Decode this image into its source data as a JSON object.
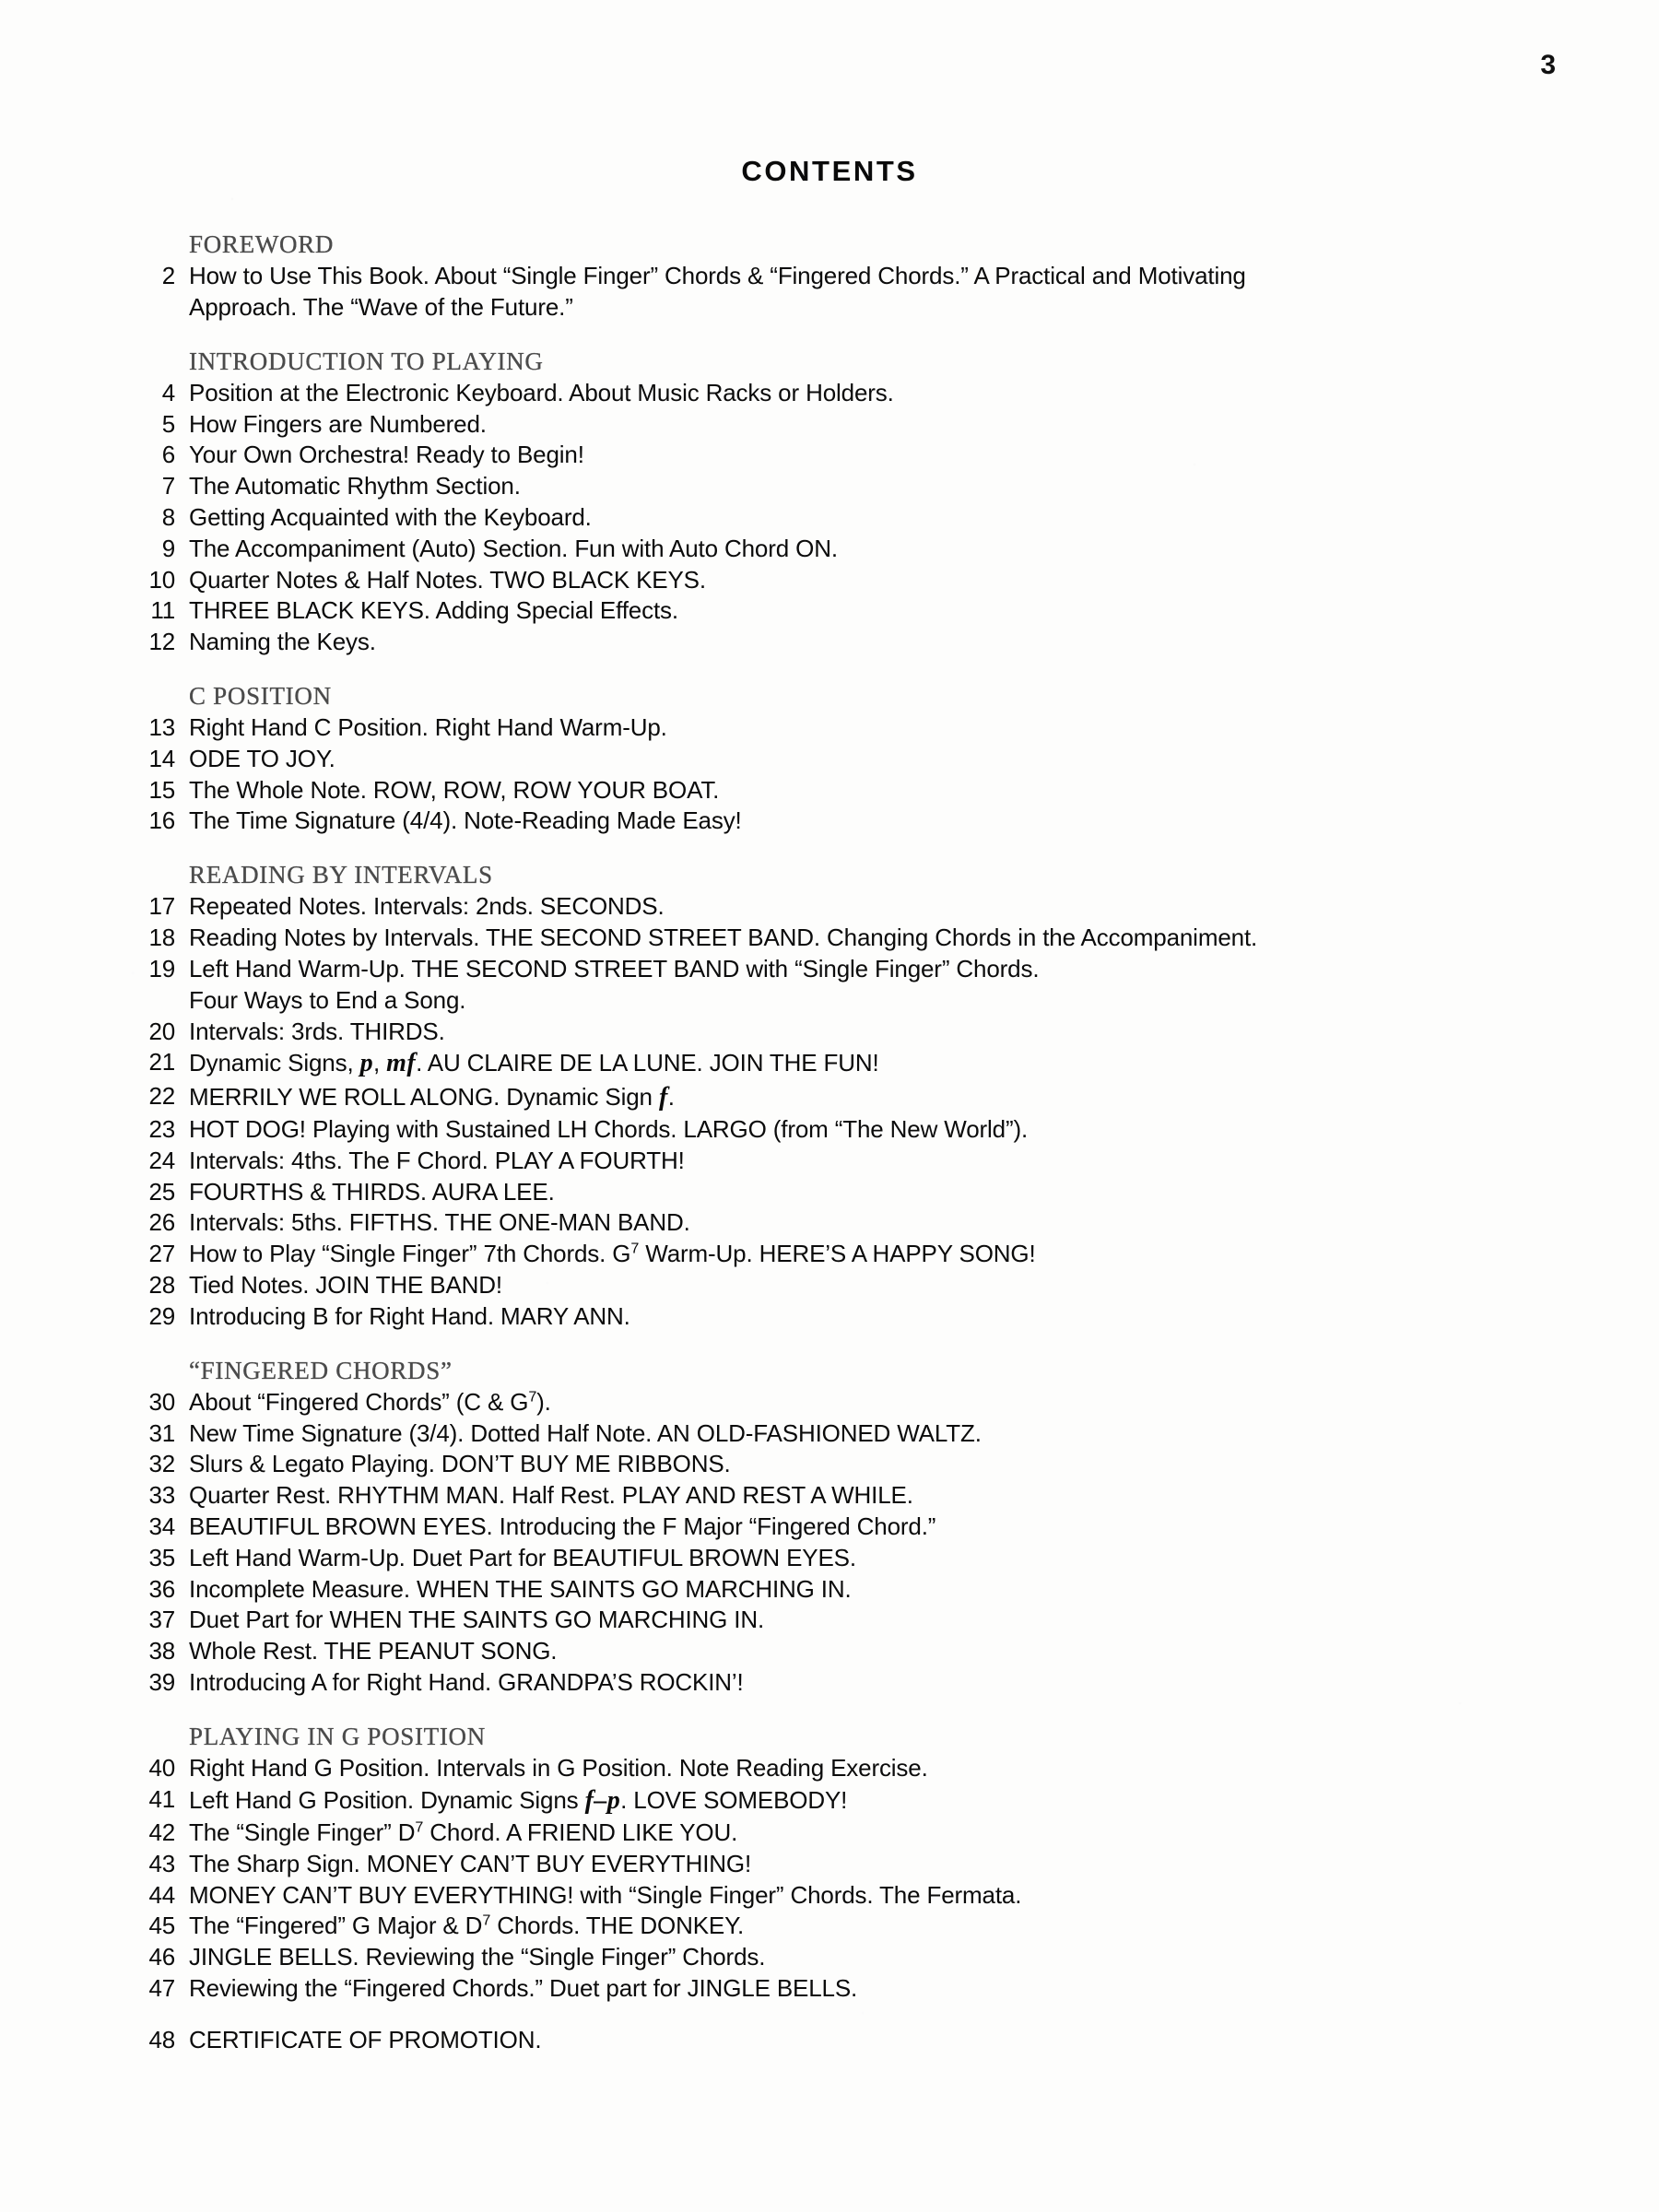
{
  "page": {
    "folio": "3",
    "title": "CONTENTS"
  },
  "toc": {
    "sections": [
      {
        "heading": "FOREWORD",
        "entries": [
          {
            "number": "2",
            "text": "How to Use This Book.  About “Single Finger” Chords & “Fingered Chords.”  A Practical and Motivating",
            "continuation": "Approach.  The “Wave of the Future.”"
          }
        ]
      },
      {
        "heading": "INTRODUCTION TO PLAYING",
        "entries": [
          {
            "number": "4",
            "text": "Position at the Electronic Keyboard.  About Music Racks or Holders."
          },
          {
            "number": "5",
            "text": "How Fingers are Numbered."
          },
          {
            "number": "6",
            "text": "Your Own Orchestra!  Ready to Begin!"
          },
          {
            "number": "7",
            "text": "The Automatic Rhythm Section."
          },
          {
            "number": "8",
            "text": "Getting Acquainted with the Keyboard."
          },
          {
            "number": "9",
            "text": "The Accompaniment (Auto) Section.  Fun with Auto Chord ON."
          },
          {
            "number": "10",
            "text": "Quarter Notes & Half Notes.  TWO BLACK KEYS."
          },
          {
            "number": "11",
            "text": "THREE BLACK KEYS.  Adding Special Effects."
          },
          {
            "number": "12",
            "text": "Naming the Keys."
          }
        ]
      },
      {
        "heading": "C POSITION",
        "entries": [
          {
            "number": "13",
            "text": "Right Hand C Position.  Right Hand Warm-Up."
          },
          {
            "number": "14",
            "text": "ODE TO JOY."
          },
          {
            "number": "15",
            "text": "The Whole Note.  ROW, ROW, ROW YOUR BOAT."
          },
          {
            "number": "16",
            "text": "The Time Signature (4/4).  Note-Reading Made Easy!"
          }
        ]
      },
      {
        "heading": "READING BY INTERVALS",
        "entries": [
          {
            "number": "17",
            "text": "Repeated Notes.  Intervals: 2nds.  SECONDS."
          },
          {
            "number": "18",
            "text": "Reading Notes by Intervals.  THE SECOND STREET BAND.  Changing Chords in the Accompaniment."
          },
          {
            "number": "19",
            "text": "Left Hand Warm-Up.  THE SECOND STREET BAND with “Single Finger” Chords.",
            "continuation": "Four Ways to End a Song."
          },
          {
            "number": "20",
            "text": "Intervals: 3rds.  THIRDS."
          },
          {
            "number": "21",
            "html": "Dynamic Signs, <span class=\"dyn\">p</span>, <span class=\"dyn\">mf</span>.  AU CLAIRE DE LA LUNE.  JOIN THE FUN!"
          },
          {
            "number": "22",
            "html": "MERRILY WE ROLL ALONG.  Dynamic Sign <span class=\"dyn\">f</span>."
          },
          {
            "number": "23",
            "text": "HOT DOG!  Playing with Sustained LH Chords.  LARGO (from “The New World”)."
          },
          {
            "number": "24",
            "text": "Intervals: 4ths.  The F Chord.  PLAY A FOURTH!"
          },
          {
            "number": "25",
            "text": "FOURTHS & THIRDS.  AURA LEE."
          },
          {
            "number": "26",
            "text": "Intervals: 5ths.  FIFTHS.  THE ONE-MAN BAND."
          },
          {
            "number": "27",
            "html": "How to Play “Single Finger” 7th Chords.  G<sup>7</sup> Warm-Up.  HERE’S A HAPPY SONG!"
          },
          {
            "number": "28",
            "text": "Tied Notes.  JOIN THE BAND!"
          },
          {
            "number": "29",
            "text": "Introducing B for Right Hand.  MARY ANN."
          }
        ]
      },
      {
        "heading": "“FINGERED CHORDS”",
        "entries": [
          {
            "number": "30",
            "html": "About “Fingered Chords” (C & G<sup>7</sup>)."
          },
          {
            "number": "31",
            "text": "New Time Signature (3/4).  Dotted Half Note.  AN OLD-FASHIONED WALTZ."
          },
          {
            "number": "32",
            "text": "Slurs & Legato Playing.  DON’T BUY ME RIBBONS."
          },
          {
            "number": "33",
            "text": "Quarter Rest.  RHYTHM MAN.  Half Rest.  PLAY AND REST A WHILE."
          },
          {
            "number": "34",
            "text": "BEAUTIFUL BROWN EYES.  Introducing the F Major “Fingered Chord.”"
          },
          {
            "number": "35",
            "text": "Left Hand Warm-Up.  Duet Part for BEAUTIFUL BROWN EYES."
          },
          {
            "number": "36",
            "text": "Incomplete Measure.  WHEN THE SAINTS GO MARCHING IN."
          },
          {
            "number": "37",
            "text": "Duet Part for WHEN THE SAINTS GO MARCHING IN."
          },
          {
            "number": "38",
            "text": "Whole Rest.  THE PEANUT SONG."
          },
          {
            "number": "39",
            "text": "Introducing A for Right Hand.  GRANDPA’S ROCKIN’!"
          }
        ]
      },
      {
        "heading": "PLAYING IN G POSITION",
        "entries": [
          {
            "number": "40",
            "text": "Right Hand G Position.  Intervals in G Position.  Note Reading Exercise."
          },
          {
            "number": "41",
            "html": "Left Hand G Position.  Dynamic Signs <span class=\"dyn\">f–p</span>.  LOVE SOMEBODY!"
          },
          {
            "number": "42",
            "html": "The “Single Finger” D<sup>7</sup> Chord.  A FRIEND LIKE YOU."
          },
          {
            "number": "43",
            "text": "The Sharp Sign.  MONEY CAN’T BUY EVERYTHING!"
          },
          {
            "number": "44",
            "text": "MONEY CAN’T BUY EVERYTHING! with “Single Finger” Chords.  The Fermata."
          },
          {
            "number": "45",
            "html": "The “Fingered” G Major & D<sup>7</sup> Chords.  THE DONKEY."
          },
          {
            "number": "46",
            "text": "JINGLE BELLS.  Reviewing the “Single Finger” Chords."
          },
          {
            "number": "47",
            "text": "Reviewing the “Fingered Chords.”  Duet part for JINGLE BELLS."
          }
        ]
      },
      {
        "heading": null,
        "entries": [
          {
            "number": "48",
            "text": "CERTIFICATE OF PROMOTION.",
            "extra_gap": true
          }
        ]
      }
    ]
  }
}
